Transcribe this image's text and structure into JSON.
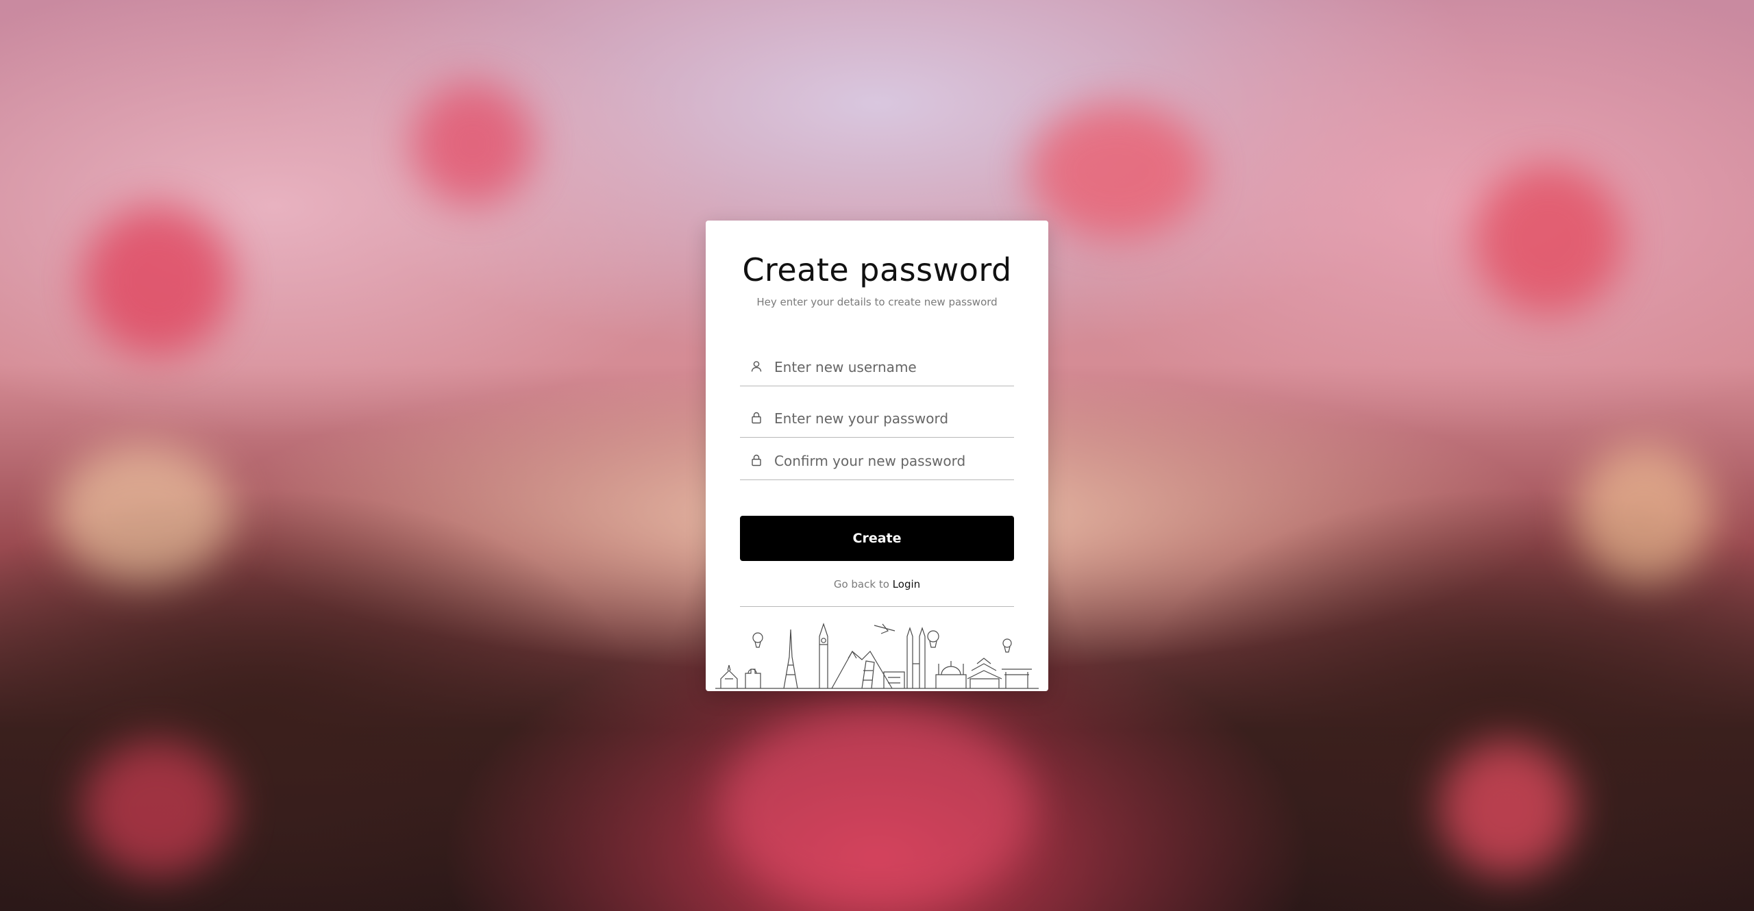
{
  "form": {
    "title": "Create password",
    "subtitle": "Hey enter your details to create new password",
    "username_placeholder": "Enter new username",
    "password_placeholder": "Enter new your password",
    "confirm_placeholder": "Confirm your new password",
    "submit_label": "Create",
    "back_text": "Go back to",
    "back_link": "Login"
  },
  "icons": {
    "username": "user-icon",
    "password": "lock-icon",
    "confirm": "lock-icon",
    "illustration": "world-landmarks-skyline"
  },
  "colors": {
    "button": "#000000",
    "card": "#ffffff",
    "muted_text": "#7a7a7a"
  }
}
